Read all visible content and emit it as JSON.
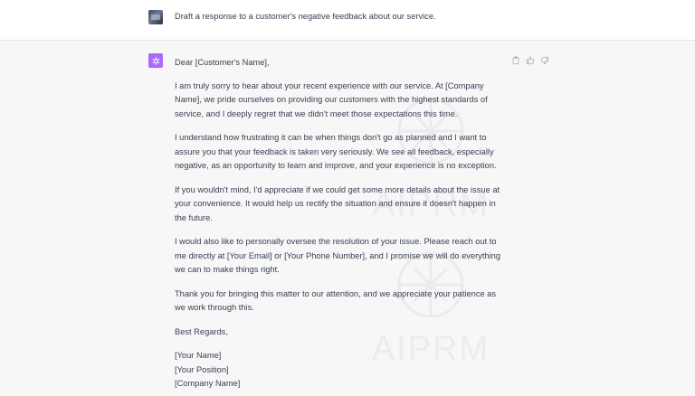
{
  "user_message": "Draft a response to a customer's negative feedback about our service.",
  "watermark": "AIPRM",
  "colors": {
    "assistant_icon_bg": "#ab68ff",
    "assistant_row_bg": "#f7f7f8",
    "user_row_bg": "#ffffff"
  },
  "response": {
    "greeting": "Dear [Customer's Name],",
    "paragraphs": [
      "I am truly sorry to hear about your recent experience with our service. At [Company Name], we pride ourselves on providing our customers with the highest standards of service, and I deeply regret that we didn't meet those expectations this time.",
      "I understand how frustrating it can be when things don't go as planned and I want to assure you that your feedback is taken very seriously. We see all feedback, especially negative, as an opportunity to learn and improve, and your experience is no exception.",
      "If you wouldn't mind, I'd appreciate if we could get some more details about the issue at your convenience. It would help us rectify the situation and ensure it doesn't happen in the future.",
      "I would also like to personally oversee the resolution of your issue. Please reach out to me directly at [Your Email] or [Your Phone Number], and I promise we will do everything we can to make things right.",
      "Thank you for bringing this matter to our attention, and we appreciate your patience as we work through this."
    ],
    "closing": "Best Regards,",
    "signature": [
      "[Your Name]",
      "[Your Position]",
      "[Company Name]"
    ]
  },
  "icons": {
    "copy": "clipboard-icon",
    "like": "thumbs-up-icon",
    "dislike": "thumbs-down-icon"
  }
}
